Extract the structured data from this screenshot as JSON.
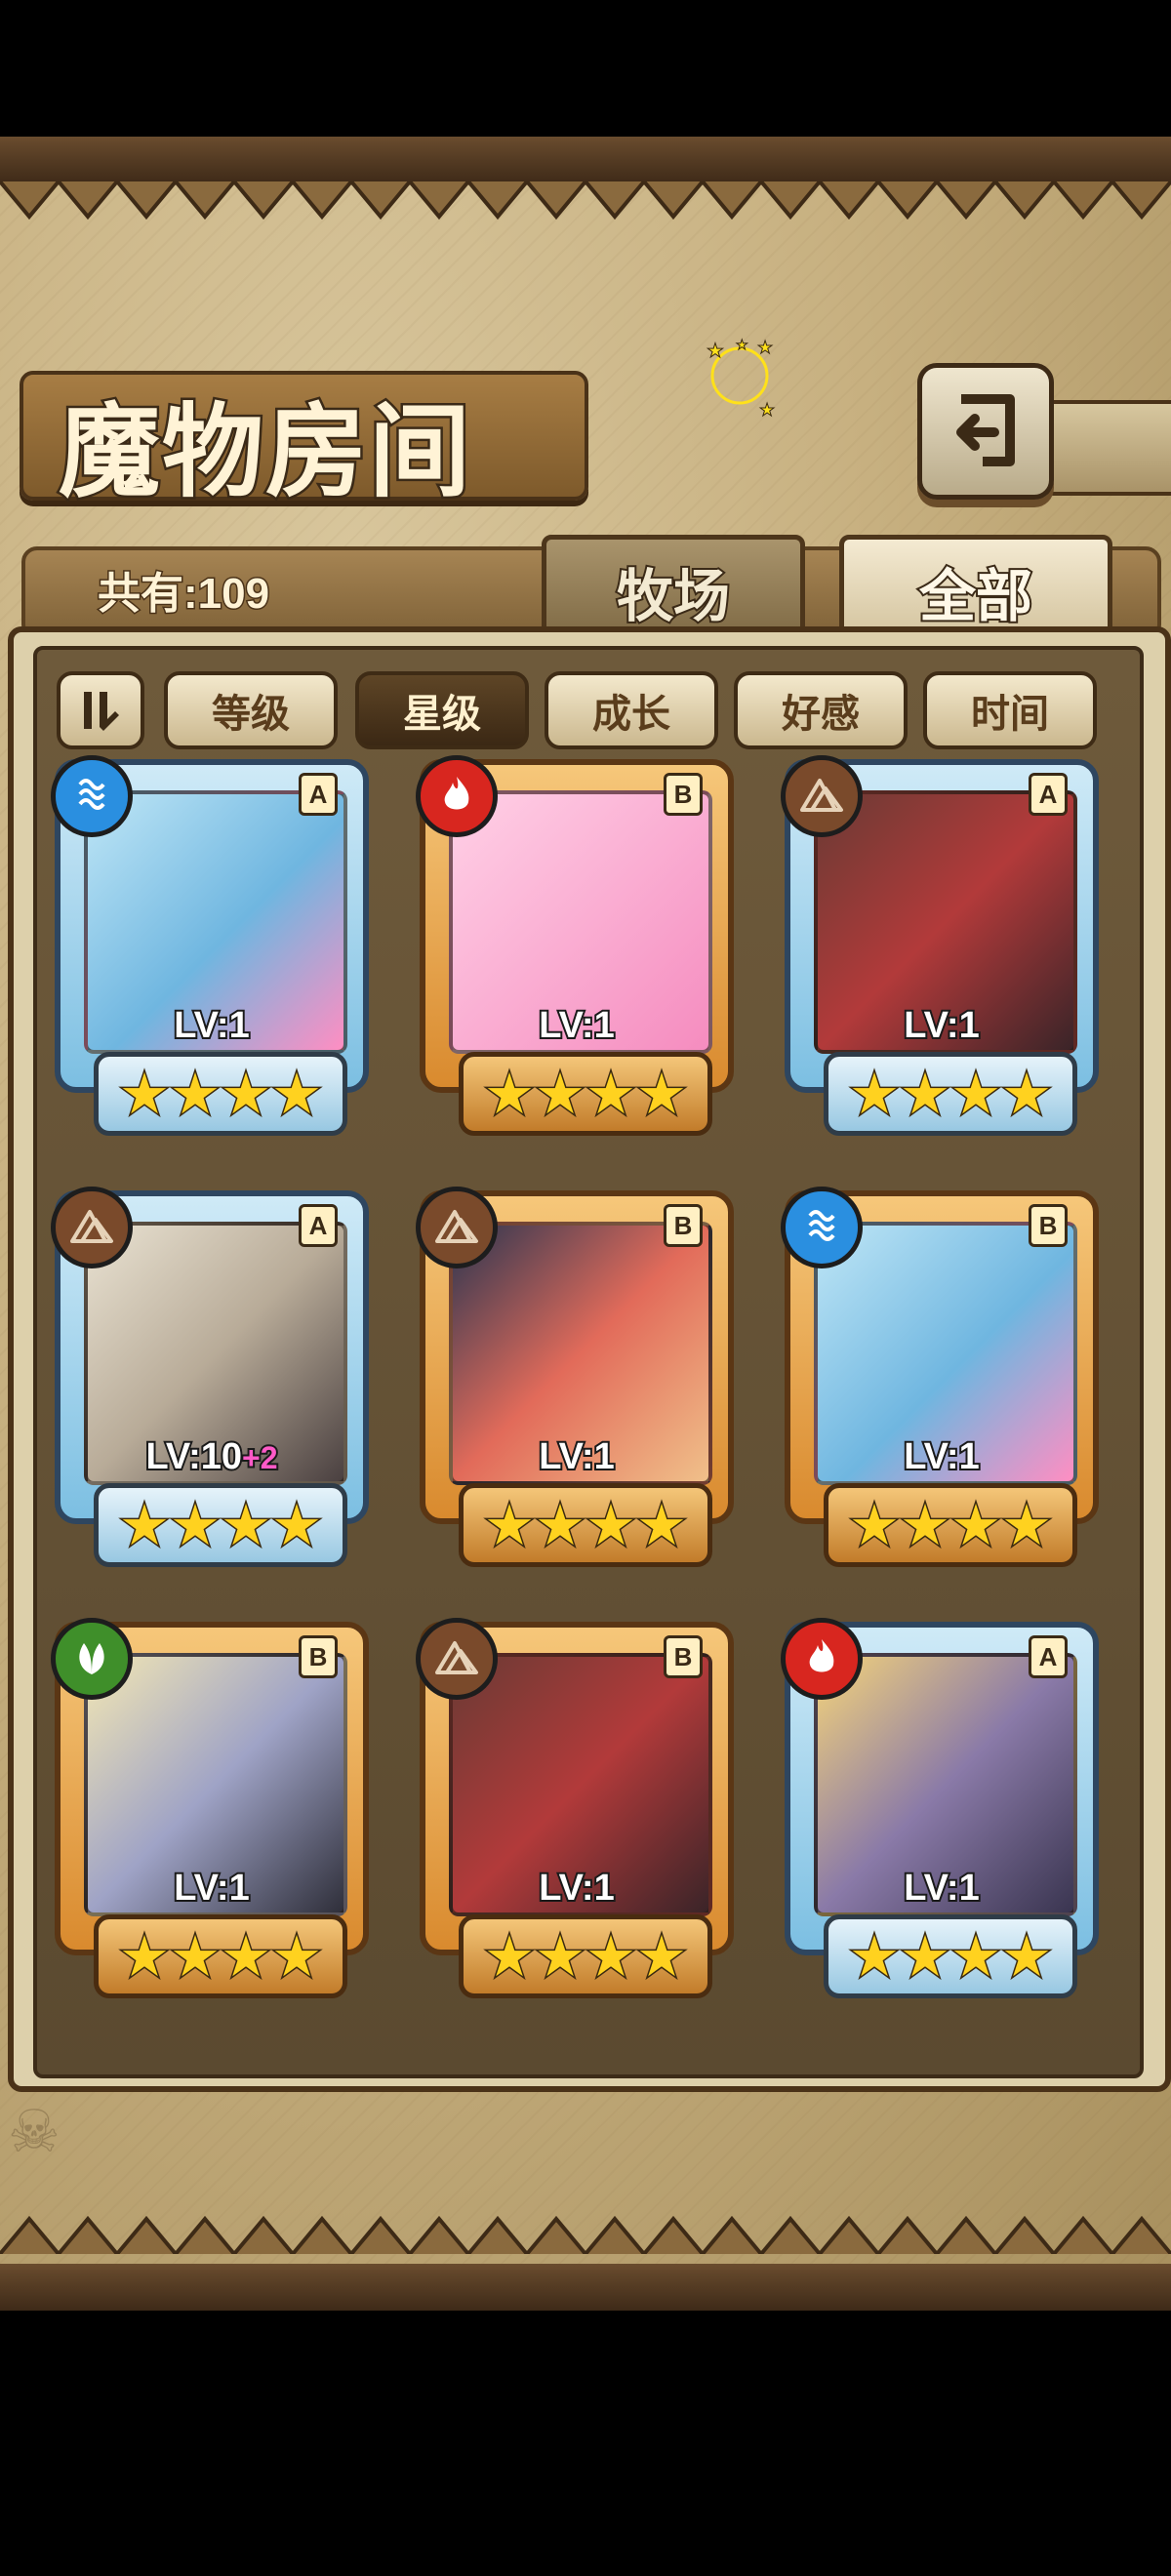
{
  "header": {
    "title": "魔物房间",
    "count_label": "共有:109"
  },
  "tabs": [
    {
      "label": "牧场"
    },
    {
      "label": "全部"
    }
  ],
  "sort_buttons": [
    {
      "label": "等级"
    },
    {
      "label": "星级",
      "active": true
    },
    {
      "label": "成长"
    },
    {
      "label": "好感"
    },
    {
      "label": "时间"
    }
  ],
  "cards": [
    {
      "rank": "A",
      "element": "water-icon",
      "level": "LV:1",
      "bonus": "",
      "frame": "blue",
      "stars": 4
    },
    {
      "rank": "B",
      "element": "fire-icon",
      "level": "LV:1",
      "bonus": "",
      "frame": "orange",
      "stars": 4
    },
    {
      "rank": "A",
      "element": "earth-icon",
      "level": "LV:1",
      "bonus": "",
      "frame": "blue",
      "stars": 4
    },
    {
      "rank": "A",
      "element": "earth-icon",
      "level": "LV:10",
      "bonus": "+2",
      "frame": "blue",
      "stars": 4
    },
    {
      "rank": "B",
      "element": "earth-icon",
      "level": "LV:1",
      "bonus": "",
      "frame": "orange",
      "stars": 4
    },
    {
      "rank": "B",
      "element": "water-icon",
      "level": "LV:1",
      "bonus": "",
      "frame": "orange",
      "stars": 4
    },
    {
      "rank": "B",
      "element": "wood-icon",
      "level": "LV:1",
      "bonus": "",
      "frame": "orange",
      "stars": 4
    },
    {
      "rank": "B",
      "element": "earth-icon",
      "level": "LV:1",
      "bonus": "",
      "frame": "orange",
      "stars": 4
    },
    {
      "rank": "A",
      "element": "fire-icon",
      "level": "LV:1",
      "bonus": "",
      "frame": "blue",
      "stars": 4
    }
  ],
  "colors": {
    "water": "#2a8fe0",
    "fire": "#d8261f",
    "earth": "#7a4a2b",
    "wood": "#3f8f2a"
  }
}
